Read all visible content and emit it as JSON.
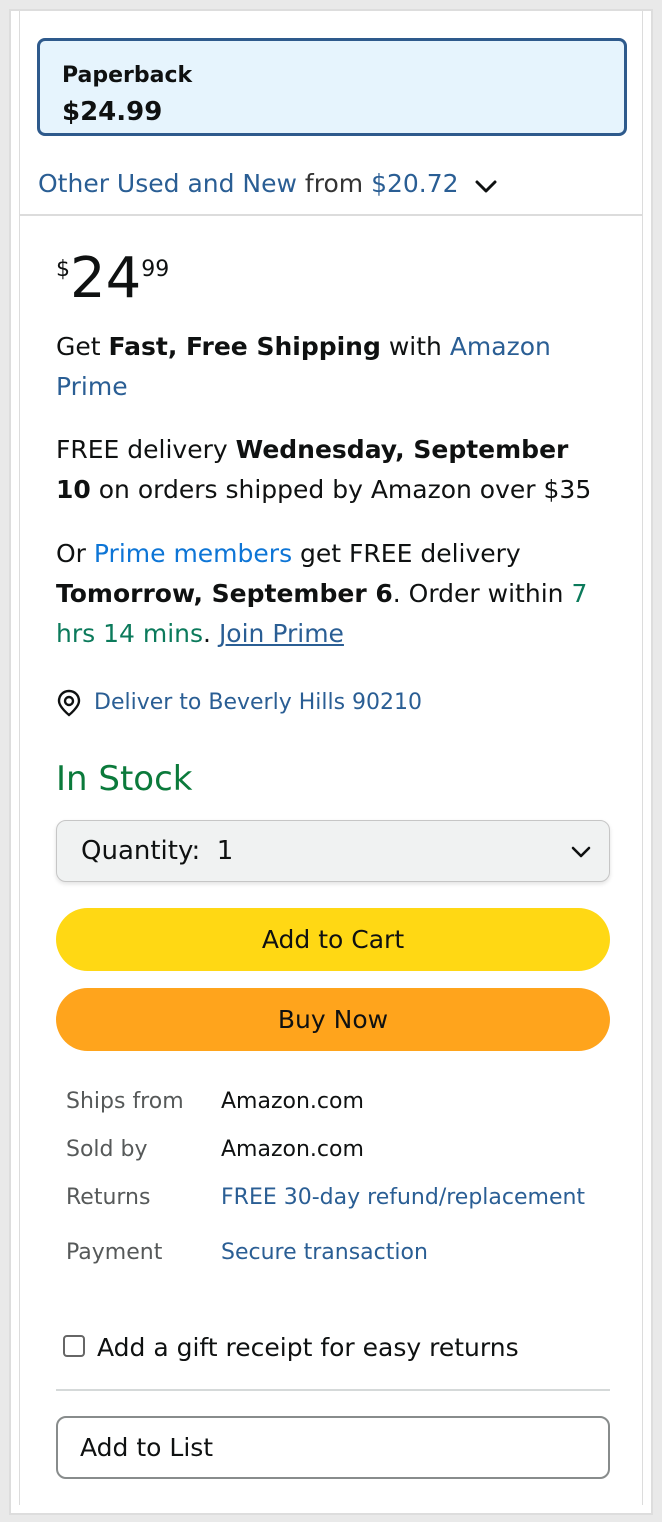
{
  "format": {
    "name": "Paperback",
    "price": "$24.99"
  },
  "other_offers": {
    "link_text": "Other Used and New",
    "middle": "from",
    "price": "$20.72"
  },
  "price": {
    "symbol": "$",
    "whole": "24",
    "fraction": "99"
  },
  "prime_promo": {
    "prefix": "Get ",
    "bold": "Fast, Free Shipping",
    "middle": " with ",
    "link": "Amazon Prime"
  },
  "free_delivery": {
    "prefix": "FREE delivery ",
    "date": "Wednesday, September 10",
    "suffix": " on orders shipped by Amazon over $35"
  },
  "prime_delivery": {
    "prefix": "Or ",
    "link": "Prime members",
    "middle": " get FREE delivery ",
    "date": "Tomorrow, September 6",
    "order_within": ". Order within ",
    "countdown": "7 hrs 14 mins",
    "dot": ". ",
    "join": "Join Prime"
  },
  "deliver_to": "Deliver to Beverly Hills 90210",
  "stock_status": "In Stock",
  "quantity": {
    "label": "Quantity:",
    "value": "1"
  },
  "buttons": {
    "add_to_cart": "Add to Cart",
    "buy_now": "Buy Now",
    "add_to_list": "Add to List"
  },
  "info": [
    {
      "label": "Ships from",
      "value": "Amazon.com"
    },
    {
      "label": "Sold by",
      "value": "Amazon.com"
    },
    {
      "label": "Returns",
      "value": "FREE 30-day refund/replacement"
    },
    {
      "label": "Payment",
      "value": "Secure transaction"
    }
  ],
  "gift_receipt": {
    "label": "Add a gift receipt for easy returns",
    "checked": false
  },
  "colors": {
    "link": "#2a5e94",
    "in_stock": "#0b7a3b",
    "add_to_cart": "#ffd814",
    "buy_now": "#ffa41c",
    "selected_format_border": "#2e5a8c",
    "selected_format_bg": "#e6f4fd"
  },
  "icons": {
    "location": "location-pin-icon",
    "dropdown": "chevron-down-icon"
  }
}
